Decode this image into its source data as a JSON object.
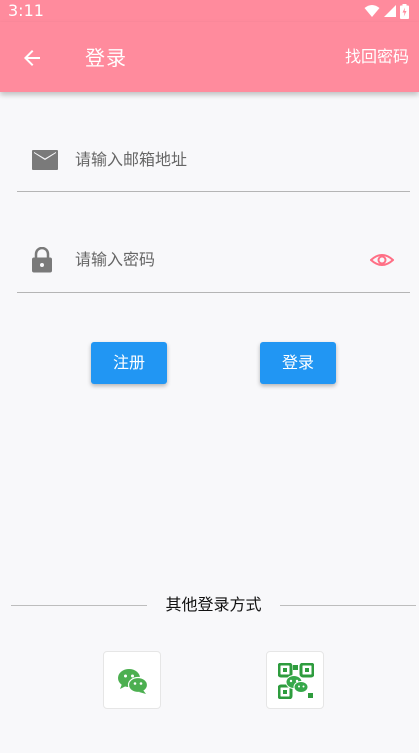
{
  "status_bar": {
    "time": "3:11",
    "icons": [
      "wifi-icon",
      "signal-icon",
      "battery-charging-icon"
    ]
  },
  "app_bar": {
    "back_icon": "back-arrow-icon",
    "title": "登录",
    "action_label": "找回密码",
    "background_color": "#ff8b9d"
  },
  "form": {
    "email": {
      "icon": "mail-icon",
      "placeholder": "请输入邮箱地址",
      "value": ""
    },
    "password": {
      "icon": "lock-icon",
      "placeholder": "请输入密码",
      "value": "",
      "toggle_icon": "eye-icon",
      "toggle_color": "#ff6f85"
    }
  },
  "buttons": {
    "register_label": "注册",
    "login_label": "登录",
    "color": "#2196f3"
  },
  "other_login": {
    "divider_text": "其他登录方式",
    "options": [
      {
        "icon": "wechat-icon"
      },
      {
        "icon": "qr-code-wechat-icon"
      }
    ]
  }
}
